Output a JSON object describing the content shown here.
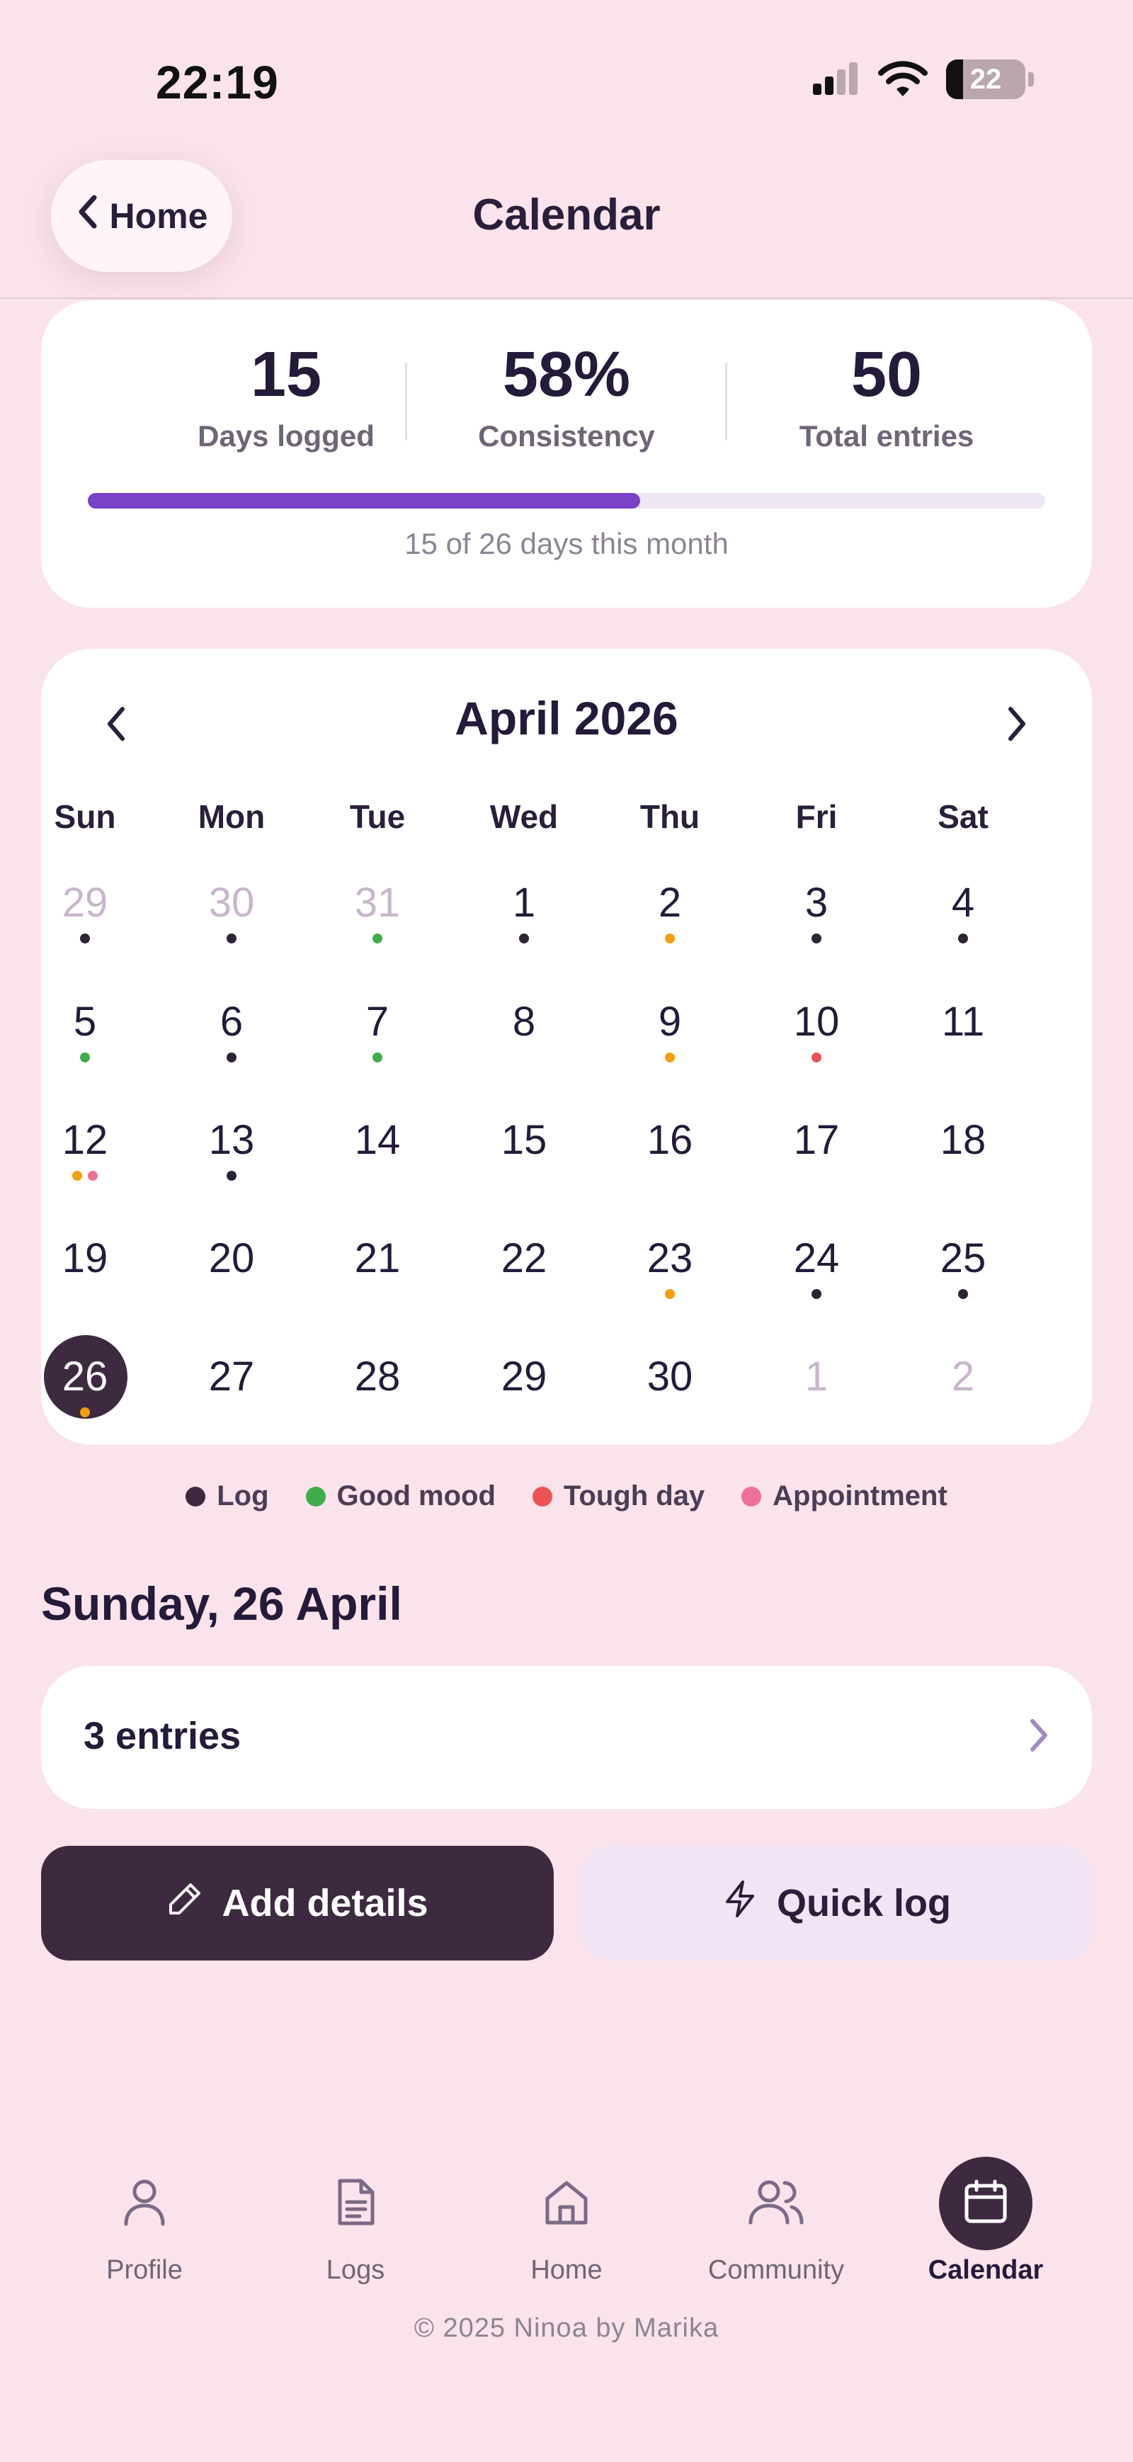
{
  "status_bar": {
    "time": "22:19",
    "battery": "22"
  },
  "header": {
    "back_label": "Home",
    "title": "Calendar"
  },
  "stats": {
    "days_logged": {
      "value": "15",
      "label": "Days logged"
    },
    "consistency": {
      "value": "58%",
      "label": "Consistency"
    },
    "total_entries": {
      "value": "50",
      "label": "Total entries"
    },
    "progress_fraction": 0.577,
    "progress_caption": "15 of 26 days this month"
  },
  "calendar": {
    "month_label": "April 2026",
    "weekdays": [
      "Sun",
      "Mon",
      "Tue",
      "Wed",
      "Thu",
      "Fri",
      "Sat"
    ],
    "days": [
      {
        "d": "29",
        "other": true,
        "dots": [
          "log"
        ]
      },
      {
        "d": "30",
        "other": true,
        "dots": [
          "log"
        ]
      },
      {
        "d": "31",
        "other": true,
        "dots": [
          "good"
        ]
      },
      {
        "d": "1",
        "dots": [
          "log"
        ]
      },
      {
        "d": "2",
        "dots": [
          "orange"
        ]
      },
      {
        "d": "3",
        "dots": [
          "log"
        ]
      },
      {
        "d": "4",
        "dots": [
          "log"
        ]
      },
      {
        "d": "5",
        "dots": [
          "good"
        ]
      },
      {
        "d": "6",
        "dots": [
          "log"
        ]
      },
      {
        "d": "7",
        "dots": [
          "good"
        ]
      },
      {
        "d": "8",
        "dots": []
      },
      {
        "d": "9",
        "dots": [
          "orange"
        ]
      },
      {
        "d": "10",
        "dots": [
          "tough"
        ]
      },
      {
        "d": "11",
        "dots": []
      },
      {
        "d": "12",
        "dots": [
          "orange",
          "appointment"
        ]
      },
      {
        "d": "13",
        "dots": [
          "log"
        ]
      },
      {
        "d": "14",
        "dots": []
      },
      {
        "d": "15",
        "dots": []
      },
      {
        "d": "16",
        "dots": []
      },
      {
        "d": "17",
        "dots": []
      },
      {
        "d": "18",
        "dots": []
      },
      {
        "d": "19",
        "dots": []
      },
      {
        "d": "20",
        "dots": []
      },
      {
        "d": "21",
        "dots": []
      },
      {
        "d": "22",
        "dots": []
      },
      {
        "d": "23",
        "dots": [
          "orange"
        ]
      },
      {
        "d": "24",
        "dots": [
          "log"
        ]
      },
      {
        "d": "25",
        "dots": [
          "log"
        ]
      },
      {
        "d": "26",
        "today": true,
        "dots": [
          "orange"
        ]
      },
      {
        "d": "27",
        "dots": []
      },
      {
        "d": "28",
        "dots": []
      },
      {
        "d": "29",
        "dots": []
      },
      {
        "d": "30",
        "dots": []
      },
      {
        "d": "1",
        "other": true,
        "dots": []
      },
      {
        "d": "2",
        "other": true,
        "dots": []
      }
    ],
    "dot_colors": {
      "log": "#2e2438",
      "good": "#3fae4a",
      "tough": "#ec5353",
      "appointment": "#ee6f9a",
      "orange": "#f59e0b"
    }
  },
  "legend": [
    {
      "key": "log",
      "label": "Log",
      "color": "#3d2a40"
    },
    {
      "key": "good",
      "label": "Good mood",
      "color": "#3fae4a"
    },
    {
      "key": "tough",
      "label": "Tough day",
      "color": "#ec5353"
    },
    {
      "key": "appointment",
      "label": "Appointment",
      "color": "#ee6f9a"
    }
  ],
  "selected": {
    "date_label": "Sunday, 26 April",
    "entries_label": "3 entries"
  },
  "actions": {
    "add_details": "Add details",
    "quick_log": "Quick log"
  },
  "bottom_nav": [
    {
      "key": "profile",
      "label": "Profile",
      "icon": "person-icon"
    },
    {
      "key": "logs",
      "label": "Logs",
      "icon": "document-icon"
    },
    {
      "key": "home",
      "label": "Home",
      "icon": "house-icon"
    },
    {
      "key": "community",
      "label": "Community",
      "icon": "people-icon"
    },
    {
      "key": "calendar",
      "label": "Calendar",
      "icon": "calendar-icon",
      "active": true
    }
  ],
  "footer": "© 2025 Ninoa by Marika",
  "colors": {
    "accent": "#7a42c8",
    "dark": "#3d2a40",
    "background": "#fae3ea"
  }
}
